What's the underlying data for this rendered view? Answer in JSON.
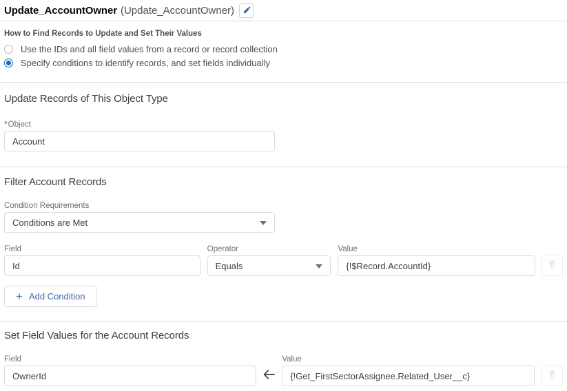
{
  "header": {
    "name": "Update_AccountOwner",
    "api_name": "(Update_AccountOwner)",
    "edit_icon": "pencil-icon"
  },
  "how_to_find": {
    "legend": "How to Find Records to Update and Set Their Values",
    "options": [
      {
        "label": "Use the IDs and all field values from a record or record collection",
        "selected": false
      },
      {
        "label": "Specify conditions to identify records, and set fields individually",
        "selected": true
      }
    ]
  },
  "object_section": {
    "heading": "Update Records of This Object Type",
    "object_label": "Object",
    "object_required": "*",
    "object_value": "Account"
  },
  "filter_section": {
    "heading": "Filter Account Records",
    "condition_requirements_label": "Condition Requirements",
    "condition_requirements_value": "Conditions are Met",
    "columns": {
      "field": "Field",
      "operator": "Operator",
      "value": "Value"
    },
    "conditions": [
      {
        "field": "Id",
        "operator": "Equals",
        "value": "{!$Record.AccountId}",
        "delete_icon": "trash-icon"
      }
    ],
    "add_condition_label": "Add Condition",
    "add_condition_icon": "plus-icon"
  },
  "set_values_section": {
    "heading": "Set Field Values for the Account Records",
    "columns": {
      "field": "Field",
      "value": "Value"
    },
    "assignments": [
      {
        "field": "OwnerId",
        "arrow_icon": "arrow-left-icon",
        "value": "{!Get_FirstSectorAssignee.Related_User__c}",
        "delete_icon": "trash-icon"
      }
    ]
  },
  "colors": {
    "accent_blue": "#0d6bc4",
    "link_blue": "#3a6db5",
    "required_red": "#c23934",
    "border_grey": "#dddbda",
    "text_primary": "#3e3e3c",
    "text_secondary": "#706e6b"
  }
}
